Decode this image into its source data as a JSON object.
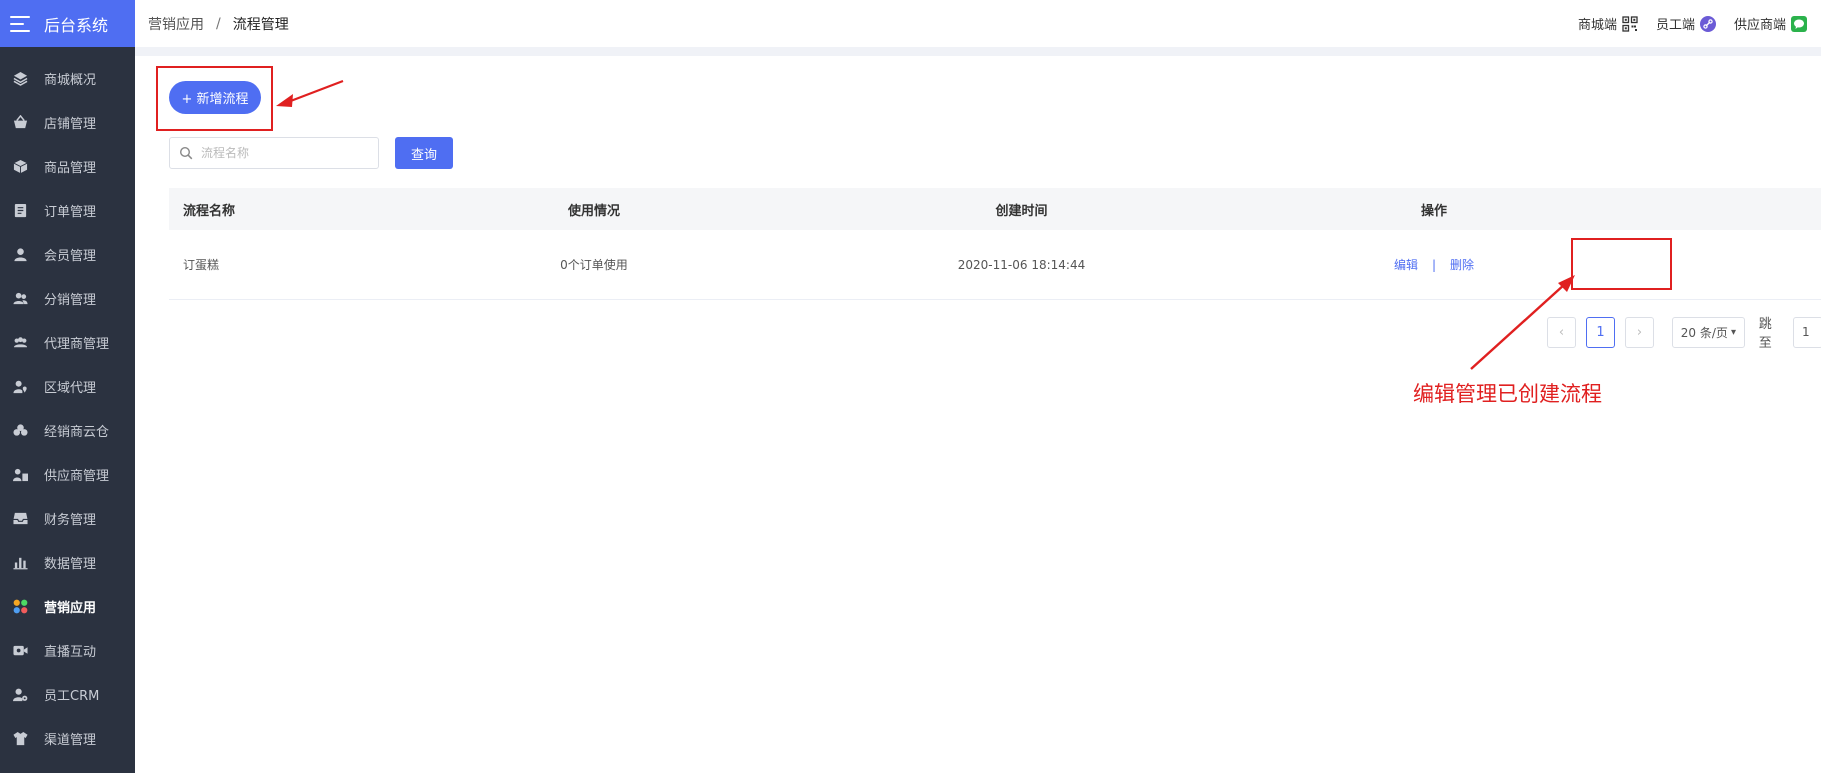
{
  "brand": {
    "title": "后台系统"
  },
  "sidebar": {
    "items": [
      {
        "label": "商城概况",
        "icon": "layers-icon"
      },
      {
        "label": "店铺管理",
        "icon": "basket-icon"
      },
      {
        "label": "商品管理",
        "icon": "box-icon"
      },
      {
        "label": "订单管理",
        "icon": "document-icon"
      },
      {
        "label": "会员管理",
        "icon": "user-icon"
      },
      {
        "label": "分销管理",
        "icon": "users-icon"
      },
      {
        "label": "代理商管理",
        "icon": "group-icon"
      },
      {
        "label": "区域代理",
        "icon": "user-location-icon"
      },
      {
        "label": "经销商云仓",
        "icon": "cloud-icon"
      },
      {
        "label": "供应商管理",
        "icon": "user-building-icon"
      },
      {
        "label": "财务管理",
        "icon": "inbox-icon"
      },
      {
        "label": "数据管理",
        "icon": "bar-chart-icon"
      },
      {
        "label": "营销应用",
        "icon": "apps-icon"
      },
      {
        "label": "直播互动",
        "icon": "video-icon"
      },
      {
        "label": "员工CRM",
        "icon": "user-gear-icon"
      },
      {
        "label": "渠道管理",
        "icon": "shirt-icon"
      }
    ]
  },
  "header": {
    "breadcrumb": {
      "parent": "营销应用",
      "separator": "/",
      "current": "流程管理"
    },
    "links": [
      {
        "label": "商城端",
        "icon": "qrcode-icon"
      },
      {
        "label": "员工端",
        "icon": "link-icon"
      },
      {
        "label": "供应商端",
        "icon": "wechat-icon"
      }
    ]
  },
  "main": {
    "add_button_label": "+ 新增流程",
    "search": {
      "placeholder": "流程名称",
      "button_label": "查询"
    },
    "table": {
      "columns": [
        "流程名称",
        "使用情况",
        "创建时间",
        "操作"
      ],
      "rows": [
        {
          "name": "订蛋糕",
          "usage": "0个订单使用",
          "created": "2020-11-06 18:14:44",
          "edit": "编辑",
          "delete": "删除",
          "pipe": "|"
        }
      ]
    },
    "pagination": {
      "prev": "‹",
      "current_page": "1",
      "next": "›",
      "page_size": "20 条/页",
      "jump_label": "跳至",
      "jump_value": "1"
    },
    "annotation": {
      "text": "编辑管理已创建流程"
    }
  },
  "colors": {
    "accent": "#4f6ef2",
    "sidebar_bg": "#2b3240",
    "annotation": "#e02020"
  }
}
